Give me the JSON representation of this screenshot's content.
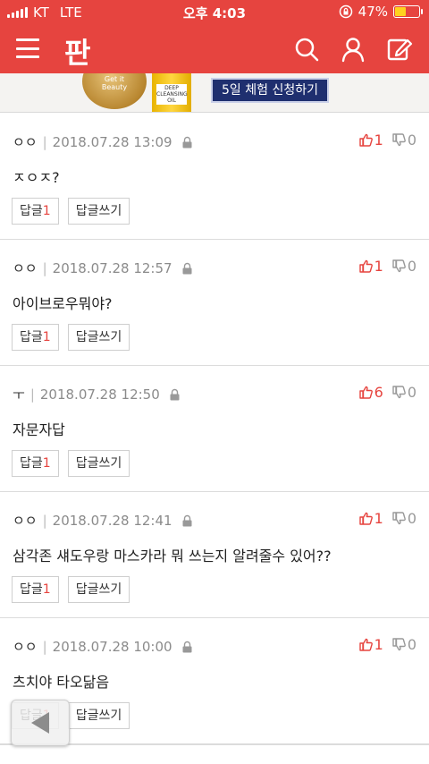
{
  "status_bar": {
    "carrier": "KT",
    "network": "LTE",
    "time": "오후 4:03",
    "battery_percent": "47%",
    "battery_level": 0.47,
    "colors": {
      "bar": "#e6443f",
      "battery_fill": "#ffd21e"
    }
  },
  "header": {
    "logo": "판",
    "icons": [
      "menu-icon",
      "search-icon",
      "user-icon",
      "write-icon"
    ]
  },
  "banner": {
    "jar_brand": "Get it Beauty",
    "bottle_label": "DEEP CLEANSING OIL",
    "cta": "5일 체험 신청하기"
  },
  "comments": [
    {
      "author": "ㅇㅇ",
      "date": "2018.07.28 13:09",
      "text": "ㅈㅇㅈ?",
      "likes": "1",
      "dislikes": "0",
      "reply_label": "답글",
      "reply_count": "1",
      "write_label": "답글쓰기"
    },
    {
      "author": "ㅇㅇ",
      "date": "2018.07.28 12:57",
      "text": "아이브로우뭐야?",
      "likes": "1",
      "dislikes": "0",
      "reply_label": "답글",
      "reply_count": "1",
      "write_label": "답글쓰기"
    },
    {
      "author": "ㅜ",
      "date": "2018.07.28 12:50",
      "text": "자문자답",
      "likes": "6",
      "dislikes": "0",
      "reply_label": "답글",
      "reply_count": "1",
      "write_label": "답글쓰기"
    },
    {
      "author": "ㅇㅇ",
      "date": "2018.07.28 12:41",
      "text": "삼각존 섀도우랑 마스카라 뭐 쓰는지 알려줄수 있어??",
      "likes": "1",
      "dislikes": "0",
      "reply_label": "답글",
      "reply_count": "1",
      "write_label": "답글쓰기"
    },
    {
      "author": "ㅇㅇ",
      "date": "2018.07.28 10:00",
      "text": "츠치야 타오닮음",
      "likes": "1",
      "dislikes": "0",
      "reply_label": "답글",
      "reply_count": "1",
      "write_label": "답글쓰기"
    }
  ],
  "colors": {
    "accent": "#e6443f",
    "muted": "#999999"
  }
}
